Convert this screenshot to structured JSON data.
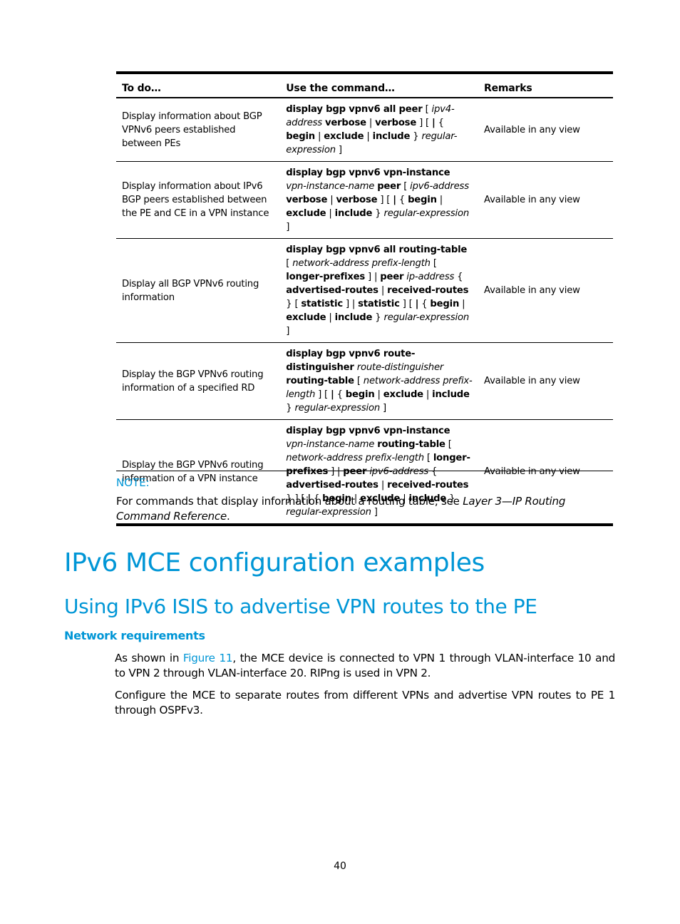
{
  "table": {
    "headers": {
      "todo": "To do…",
      "command": "Use the command…",
      "remarks": "Remarks"
    },
    "rows": [
      {
        "todo": "Display information about BGP VPNv6 peers established between PEs",
        "command_segments": [
          {
            "t": "display bgp vpnv6 all peer",
            "s": "kw"
          },
          {
            "t": " [ ",
            "s": ""
          },
          {
            "t": "ipv4-address",
            "s": "arg"
          },
          {
            "t": " ",
            "s": ""
          },
          {
            "t": "verbose",
            "s": "kw"
          },
          {
            "t": " | ",
            "s": ""
          },
          {
            "t": "verbose",
            "s": "kw"
          },
          {
            "t": " ] [ ",
            "s": ""
          },
          {
            "t": "|",
            "s": "kw"
          },
          {
            "t": " { ",
            "s": ""
          },
          {
            "t": "begin",
            "s": "kw"
          },
          {
            "t": " | ",
            "s": ""
          },
          {
            "t": "exclude",
            "s": "kw"
          },
          {
            "t": " | ",
            "s": ""
          },
          {
            "t": "include",
            "s": "kw"
          },
          {
            "t": " } ",
            "s": ""
          },
          {
            "t": "regular-expression",
            "s": "arg"
          },
          {
            "t": " ]",
            "s": ""
          }
        ],
        "remarks": "Available in any view"
      },
      {
        "todo": "Display information about IPv6 BGP peers established between the PE and CE in a VPN instance",
        "command_segments": [
          {
            "t": "display bgp vpnv6 vpn-instance",
            "s": "kw"
          },
          {
            "t": " ",
            "s": ""
          },
          {
            "t": "vpn-instance-name",
            "s": "arg"
          },
          {
            "t": " ",
            "s": ""
          },
          {
            "t": "peer",
            "s": "kw"
          },
          {
            "t": " [ ",
            "s": ""
          },
          {
            "t": "ipv6-address",
            "s": "arg"
          },
          {
            "t": " ",
            "s": ""
          },
          {
            "t": "verbose",
            "s": "kw"
          },
          {
            "t": " | ",
            "s": ""
          },
          {
            "t": "verbose",
            "s": "kw"
          },
          {
            "t": " ] [ ",
            "s": ""
          },
          {
            "t": "|",
            "s": "kw"
          },
          {
            "t": " { ",
            "s": ""
          },
          {
            "t": "begin",
            "s": "kw"
          },
          {
            "t": " | ",
            "s": ""
          },
          {
            "t": "exclude",
            "s": "kw"
          },
          {
            "t": " | ",
            "s": ""
          },
          {
            "t": "include",
            "s": "kw"
          },
          {
            "t": " } ",
            "s": ""
          },
          {
            "t": "regular-expression",
            "s": "arg"
          },
          {
            "t": " ]",
            "s": ""
          }
        ],
        "remarks": "Available in any view"
      },
      {
        "todo": "Display all BGP VPNv6 routing information",
        "command_segments": [
          {
            "t": "display bgp vpnv6 all routing-table",
            "s": "kw"
          },
          {
            "t": " [ ",
            "s": ""
          },
          {
            "t": "network-address prefix-length",
            "s": "arg"
          },
          {
            "t": " [ ",
            "s": ""
          },
          {
            "t": "longer-prefixes",
            "s": "kw"
          },
          {
            "t": " ] | ",
            "s": ""
          },
          {
            "t": "peer",
            "s": "kw"
          },
          {
            "t": " ",
            "s": ""
          },
          {
            "t": "ip-address",
            "s": "arg"
          },
          {
            "t": " { ",
            "s": ""
          },
          {
            "t": "advertised-routes",
            "s": "kw"
          },
          {
            "t": " | ",
            "s": ""
          },
          {
            "t": "received-routes",
            "s": "kw"
          },
          {
            "t": " } [ ",
            "s": ""
          },
          {
            "t": "statistic",
            "s": "kw"
          },
          {
            "t": " ] | ",
            "s": ""
          },
          {
            "t": "statistic",
            "s": "kw"
          },
          {
            "t": " ] [ ",
            "s": ""
          },
          {
            "t": "|",
            "s": "kw"
          },
          {
            "t": " { ",
            "s": ""
          },
          {
            "t": "begin",
            "s": "kw"
          },
          {
            "t": " | ",
            "s": ""
          },
          {
            "t": "exclude",
            "s": "kw"
          },
          {
            "t": " | ",
            "s": ""
          },
          {
            "t": "include",
            "s": "kw"
          },
          {
            "t": " } ",
            "s": ""
          },
          {
            "t": "regular-expression",
            "s": "arg"
          },
          {
            "t": " ]",
            "s": ""
          }
        ],
        "remarks": "Available in any view"
      },
      {
        "todo": "Display the BGP VPNv6 routing information of a specified RD",
        "command_segments": [
          {
            "t": "display bgp vpnv6 route-distinguisher",
            "s": "kw"
          },
          {
            "t": " ",
            "s": ""
          },
          {
            "t": "route-distinguisher",
            "s": "arg"
          },
          {
            "t": " ",
            "s": ""
          },
          {
            "t": "routing-table",
            "s": "kw"
          },
          {
            "t": " [ ",
            "s": ""
          },
          {
            "t": "network-address prefix-length",
            "s": "arg"
          },
          {
            "t": " ] [ ",
            "s": ""
          },
          {
            "t": "|",
            "s": "kw"
          },
          {
            "t": " { ",
            "s": ""
          },
          {
            "t": "begin",
            "s": "kw"
          },
          {
            "t": " | ",
            "s": ""
          },
          {
            "t": "exclude",
            "s": "kw"
          },
          {
            "t": " | ",
            "s": ""
          },
          {
            "t": "include",
            "s": "kw"
          },
          {
            "t": " } ",
            "s": ""
          },
          {
            "t": "regular-expression",
            "s": "arg"
          },
          {
            "t": " ]",
            "s": ""
          }
        ],
        "remarks": "Available in any view"
      },
      {
        "todo": "Display the BGP VPNv6 routing information of a VPN instance",
        "command_segments": [
          {
            "t": "display bgp vpnv6 vpn-instance",
            "s": "kw"
          },
          {
            "t": " ",
            "s": ""
          },
          {
            "t": "vpn-instance-name",
            "s": "arg"
          },
          {
            "t": " ",
            "s": ""
          },
          {
            "t": "routing-table",
            "s": "kw"
          },
          {
            "t": " [ ",
            "s": ""
          },
          {
            "t": "network-address prefix-length",
            "s": "arg"
          },
          {
            "t": " [ ",
            "s": ""
          },
          {
            "t": "longer-prefixes",
            "s": "kw"
          },
          {
            "t": " ] | ",
            "s": ""
          },
          {
            "t": "peer",
            "s": "kw"
          },
          {
            "t": " ",
            "s": ""
          },
          {
            "t": "ipv6-address",
            "s": "arg"
          },
          {
            "t": " { ",
            "s": ""
          },
          {
            "t": "advertised-routes",
            "s": "kw"
          },
          {
            "t": " | ",
            "s": ""
          },
          {
            "t": "received-routes",
            "s": "kw"
          },
          {
            "t": " } ] [ ",
            "s": ""
          },
          {
            "t": "|",
            "s": "kw"
          },
          {
            "t": " { ",
            "s": ""
          },
          {
            "t": "begin",
            "s": "kw"
          },
          {
            "t": " | ",
            "s": ""
          },
          {
            "t": "exclude",
            "s": "kw"
          },
          {
            "t": " | ",
            "s": ""
          },
          {
            "t": "include",
            "s": "kw"
          },
          {
            "t": " } ",
            "s": ""
          },
          {
            "t": "regular-expression",
            "s": "arg"
          },
          {
            "t": " ]",
            "s": ""
          }
        ],
        "remarks": "Available in any view"
      }
    ]
  },
  "note": {
    "label": "NOTE:",
    "text_before": "For commands that display information about a routing table, see ",
    "text_italic": "Layer 3—IP Routing Command Reference",
    "text_after": "."
  },
  "headings": {
    "h1": "IPv6 MCE configuration examples",
    "h2": "Using IPv6 ISIS to advertise VPN routes to the PE",
    "h3": "Network requirements"
  },
  "paragraphs": {
    "p1_before": "As shown in ",
    "p1_link": "Figure 11",
    "p1_after": ", the MCE device is connected to VPN 1 through VLAN-interface 10 and to VPN 2 through VLAN-interface 20. RIPng is used in VPN 2.",
    "p2": "Configure the MCE to separate routes from different VPNs and advertise VPN routes to PE 1 through OSPFv3."
  },
  "page_number": "40",
  "colors": {
    "accent": "#0096d6",
    "text": "#000000"
  }
}
